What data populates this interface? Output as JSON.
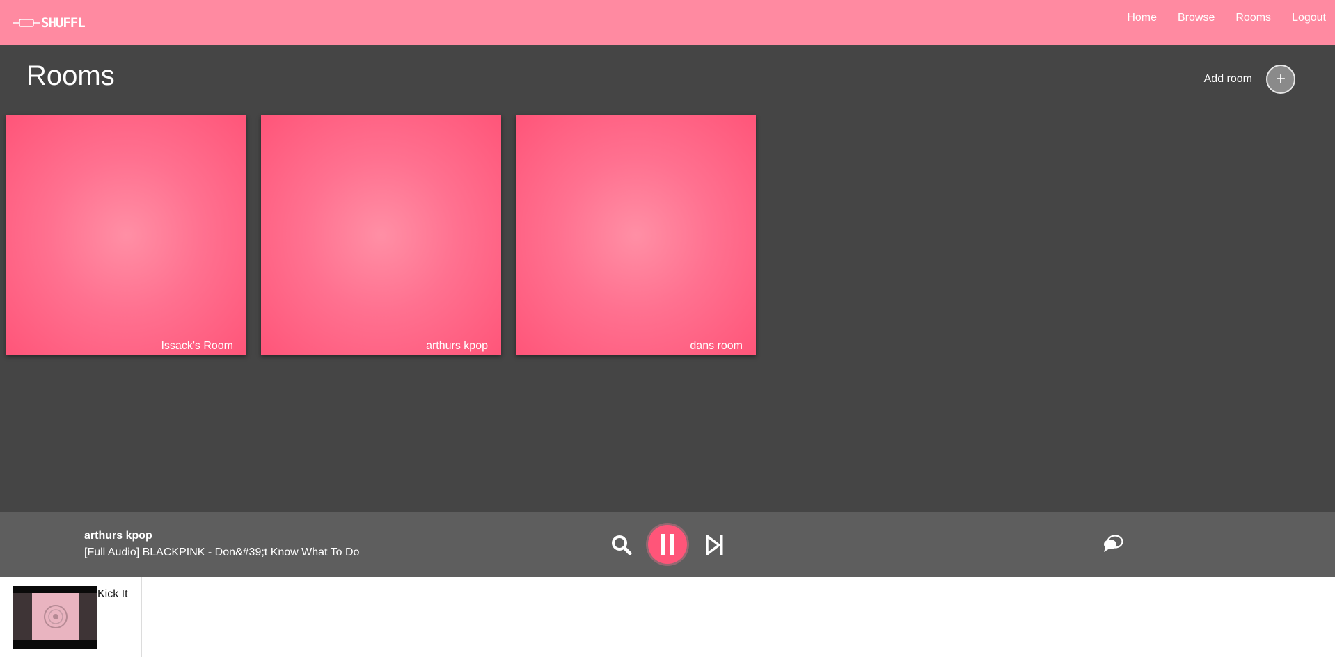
{
  "header": {
    "logo_text": "SHUFFL",
    "nav": [
      "Home",
      "Browse",
      "Rooms",
      "Logout"
    ]
  },
  "page": {
    "title": "Rooms",
    "add_room_label": "Add room",
    "add_room_icon": "+"
  },
  "rooms": [
    {
      "name": "Issack's Room"
    },
    {
      "name": "arthurs kpop"
    },
    {
      "name": "dans room"
    }
  ],
  "player": {
    "room": "arthurs kpop",
    "track": "[Full Audio] BLACKPINK - Don&#39;t Know What To Do",
    "icons": [
      "search-icon",
      "pause-icon",
      "skip-next-icon",
      "chat-icon"
    ]
  },
  "queue": [
    {
      "title": "Kick It",
      "icon": "album-thumbnail"
    }
  ],
  "colors": {
    "brand": "#ff8aa1",
    "accent": "#ff5579",
    "background": "#454545",
    "player_bar": "#5e5e5e"
  }
}
